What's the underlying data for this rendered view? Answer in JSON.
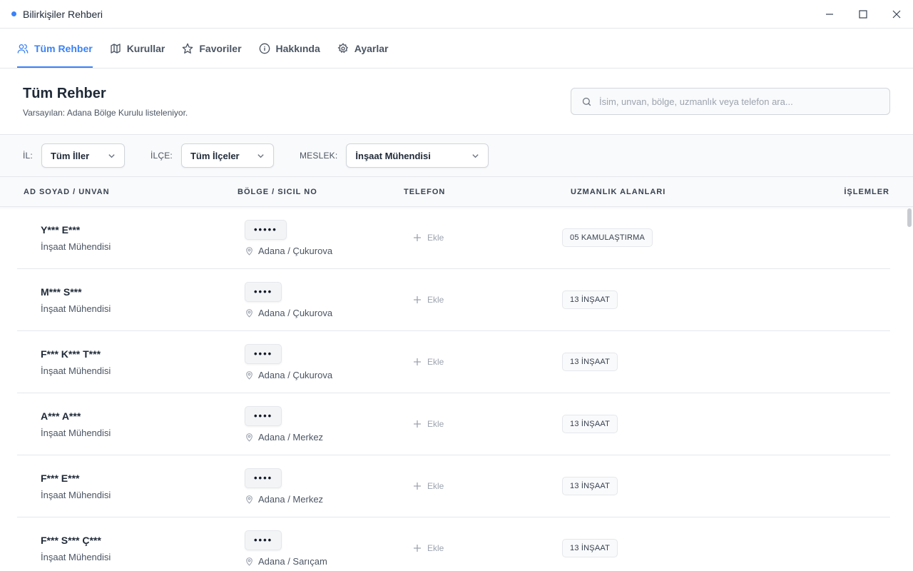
{
  "window": {
    "title": "Bilirkişiler Rehberi"
  },
  "nav": {
    "tabs": [
      {
        "label": "Tüm Rehber",
        "icon": "users-icon",
        "active": true
      },
      {
        "label": "Kurullar",
        "icon": "map-icon",
        "active": false
      },
      {
        "label": "Favoriler",
        "icon": "star-icon",
        "active": false
      },
      {
        "label": "Hakkında",
        "icon": "info-icon",
        "active": false
      },
      {
        "label": "Ayarlar",
        "icon": "gear-icon",
        "active": false
      }
    ]
  },
  "header": {
    "title": "Tüm Rehber",
    "subtitle": "Varsayılan: Adana Bölge Kurulu listeleniyor.",
    "search_placeholder": "İsim, unvan, bölge, uzmanlık veya telefon ara..."
  },
  "filters": {
    "il_label": "İL:",
    "il_value": "Tüm İller",
    "ilce_label": "İLÇE:",
    "ilce_value": "Tüm İlçeler",
    "meslek_label": "MESLEK:",
    "meslek_value": "İnşaat Mühendisi"
  },
  "table": {
    "headers": [
      "AD SOYAD / UNVAN",
      "BÖLGE / SICIL NO",
      "TELEFON",
      "UZMANLIK ALANLARI",
      "İŞLEMLER"
    ],
    "add_label": "Ekle",
    "rows": [
      {
        "name": "Y*** E***",
        "title": "İnşaat Mühendisi",
        "sicil": "•••••",
        "location": "Adana / Çukurova",
        "specialty": "05 KAMULAŞTIRMA"
      },
      {
        "name": "M*** S***",
        "title": "İnşaat Mühendisi",
        "sicil": "••••",
        "location": "Adana / Çukurova",
        "specialty": "13 İNŞAAT"
      },
      {
        "name": "F*** K*** T***",
        "title": "İnşaat Mühendisi",
        "sicil": "••••",
        "location": "Adana / Çukurova",
        "specialty": "13 İNŞAAT"
      },
      {
        "name": "A*** A***",
        "title": "İnşaat Mühendisi",
        "sicil": "••••",
        "location": "Adana / Merkez",
        "specialty": "13 İNŞAAT"
      },
      {
        "name": "F*** E***",
        "title": "İnşaat Mühendisi",
        "sicil": "••••",
        "location": "Adana / Merkez",
        "specialty": "13 İNŞAAT"
      },
      {
        "name": "F*** S*** Ç***",
        "title": "İnşaat Mühendisi",
        "sicil": "••••",
        "location": "Adana / Sarıçam",
        "specialty": "13 İNŞAAT"
      }
    ]
  },
  "colors": {
    "accent": "#3b82f6"
  }
}
